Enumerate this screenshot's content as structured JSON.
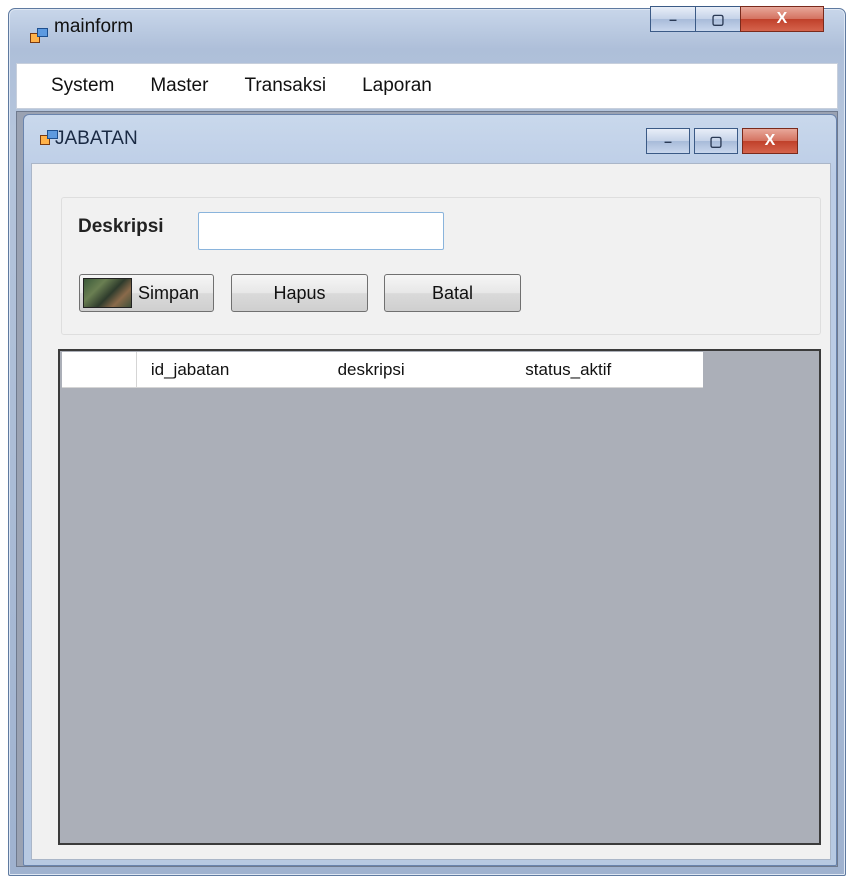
{
  "window": {
    "title": "mainform",
    "minimize": "–",
    "maximize": "▢",
    "close": "X"
  },
  "menu": {
    "items": [
      {
        "label": "System"
      },
      {
        "label": "Master"
      },
      {
        "label": "Transaksi"
      },
      {
        "label": "Laporan"
      }
    ]
  },
  "child_window": {
    "title": "JABATAN",
    "minimize": "–",
    "maximize": "▢",
    "close": "X"
  },
  "form": {
    "deskripsi_label": "Deskripsi",
    "deskripsi_value": "",
    "buttons": {
      "simpan": "Simpan",
      "hapus": "Hapus",
      "batal": "Batal"
    }
  },
  "grid": {
    "columns": [
      "id_jabatan",
      "deskripsi",
      "status_aktif"
    ],
    "rows": []
  },
  "colors": {
    "title_accent": "#c0402a",
    "grid_background": "#abafb8",
    "input_border": "#8ab4dc"
  }
}
